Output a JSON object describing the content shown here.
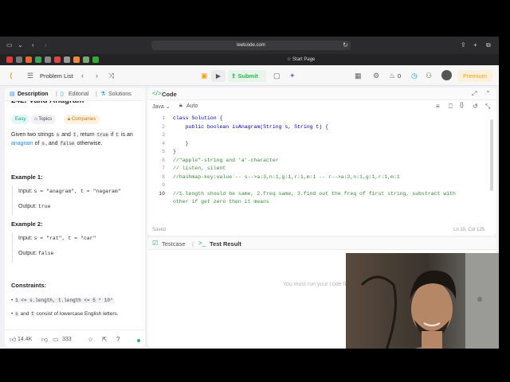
{
  "browser": {
    "url": "leetcode.com",
    "tab_label": "Start Page"
  },
  "nav": {
    "problem_list": "Problem List",
    "submit": "Submit",
    "coins": "0",
    "premium": "Premium"
  },
  "left": {
    "tabs": [
      "Description",
      "Editorial",
      "Solutions"
    ],
    "title": "242. Valid Anagram",
    "badges": [
      "Easy",
      "Topics",
      "Companies"
    ],
    "desc": {
      "p1": "Given two strings",
      "s": "s",
      "and": "and",
      "t": "t",
      "p2": ", return",
      "true": "true",
      "if": "if",
      "is_an": "is an",
      "anagram": "anagram",
      "of": "of",
      "comma_and": ", and",
      "false": "false",
      "otherwise": "otherwise."
    },
    "examples": [
      {
        "heading": "Example 1:",
        "input_label": "Input:",
        "input": "s = \"anagram\", t = \"nagaram\"",
        "output_label": "Output:",
        "output": "true"
      },
      {
        "heading": "Example 2:",
        "input_label": "Input:",
        "input": "s = \"rat\", t = \"car\"",
        "output_label": "Output:",
        "output": "false"
      }
    ],
    "constraints_heading": "Constraints:",
    "constraint1": "1 <= s.length, t.length <= 5 * 10⁴",
    "constraint2_code_s": "s",
    "constraint2_and": "and",
    "constraint2_code_t": "t",
    "constraint2_rest": "consist of lowercase English letters.",
    "likes": "14.4K",
    "comments": "333"
  },
  "code": {
    "title": "Code",
    "language": "Java",
    "mode": "Auto",
    "status": "Saved",
    "position": "Ln 10, Col 125",
    "line_numbers": [
      "1",
      "2",
      "3",
      "4",
      "5",
      "6",
      "7",
      "8",
      "9",
      "10"
    ],
    "lines": [
      "class Solution {",
      "    public boolean isAnagram(String s, String t) {",
      "",
      "    }",
      "}",
      "//\"apple\"-string and 'a'-character",
      "// listen, silent",
      "//hashmap-key:value -- s-->a:3,n:1,g:1,r:1,m:1 -- r-->a:3,n:1,g:1,r:1,m:1",
      "",
      "//1.length should be same, 2.freq same, 3.find out the freq of first string, substract with",
      "other if get zero then it means"
    ]
  },
  "test": {
    "tab_testcase": "Testcase",
    "tab_result": "Test Result",
    "message": "You must run your code first"
  },
  "colors": {
    "accent_green": "#2db55d",
    "link_blue": "#1a90ff",
    "premium_orange": "#f0a020",
    "easy_teal": "#00a58a"
  }
}
